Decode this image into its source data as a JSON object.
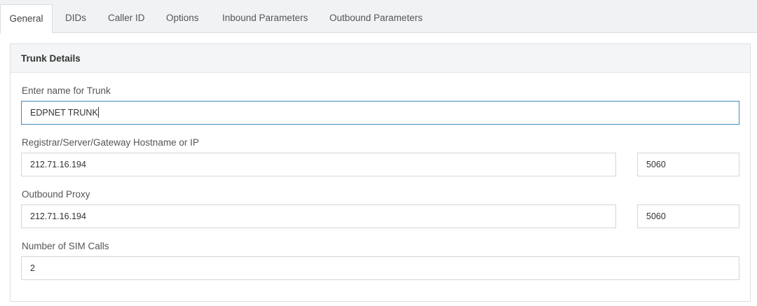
{
  "tabs": [
    {
      "label": "General",
      "active": true
    },
    {
      "label": "DIDs",
      "active": false
    },
    {
      "label": "Caller ID",
      "active": false
    },
    {
      "label": "Options",
      "active": false
    },
    {
      "label": "Inbound Parameters",
      "active": false
    },
    {
      "label": "Outbound Parameters",
      "active": false
    }
  ],
  "panel": {
    "title": "Trunk Details",
    "trunk_name": {
      "label": "Enter name for Trunk",
      "value": "EDPNET TRUNK"
    },
    "registrar": {
      "label": "Registrar/Server/Gateway Hostname or IP",
      "host": "212.71.16.194",
      "port": "5060"
    },
    "outbound_proxy": {
      "label": "Outbound Proxy",
      "host": "212.71.16.194",
      "port": "5060"
    },
    "sim_calls": {
      "label": "Number of SIM Calls",
      "value": "2"
    }
  },
  "colors": {
    "accent": "#3c8dbc",
    "tabbar_bg": "#f0f2f4",
    "panel_header_bg": "#f4f5f6"
  }
}
